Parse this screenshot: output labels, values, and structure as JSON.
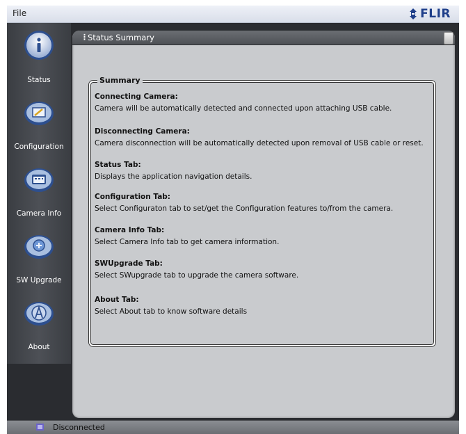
{
  "menubar": {
    "file_label": "File"
  },
  "brand": {
    "logo_text": "FLIR",
    "color": "#1f3f8a"
  },
  "sidebar": {
    "items": [
      {
        "label": "Status",
        "icon": "info-icon"
      },
      {
        "label": "Configuration",
        "icon": "configuration-icon"
      },
      {
        "label": "Camera Info",
        "icon": "camera-info-icon"
      },
      {
        "label": "SW Upgrade",
        "icon": "sw-upgrade-icon"
      },
      {
        "label": "About",
        "icon": "about-icon"
      }
    ]
  },
  "panel": {
    "title": "Status Summary",
    "group_label": "Summary",
    "sections": [
      {
        "title": "Connecting Camera:",
        "text": "Camera will be automatically detected and connected upon attaching USB cable."
      },
      {
        "title": "Disconnecting Camera:",
        "text": "Camera disconnection will be automatically detected upon removal of USB cable or reset."
      },
      {
        "title": "Status Tab:",
        "text": "Displays the application navigation details."
      },
      {
        "title": "Configuration Tab:",
        "text": "Select Configuraton tab to set/get the Configuration features to/from the camera."
      },
      {
        "title": "Camera Info Tab:",
        "text": "Select Camera Info tab to get camera information."
      },
      {
        "title": "SWUpgrade Tab:",
        "text": "Select SWupgrade tab to upgrade the camera software."
      },
      {
        "title": "About Tab:",
        "text": "Select About tab to know software details"
      }
    ]
  },
  "statusbar": {
    "text": "Disconnected",
    "icon": "usb-disconnected-icon"
  }
}
